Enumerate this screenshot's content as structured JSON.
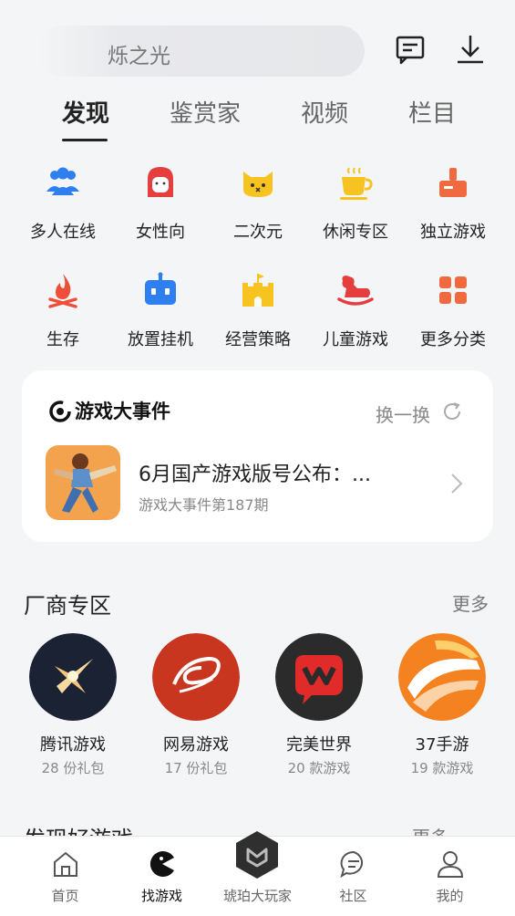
{
  "search": {
    "text": "烁之光"
  },
  "header": {
    "message_icon": "message-icon",
    "download_icon": "download-icon"
  },
  "tabs": [
    {
      "label": "发现",
      "active": true
    },
    {
      "label": "鉴赏家",
      "active": false
    },
    {
      "label": "视频",
      "active": false
    },
    {
      "label": "栏目",
      "active": false
    }
  ],
  "categories": [
    {
      "label": "多人在线",
      "icon": "people-icon",
      "color": "#2f7ff0"
    },
    {
      "label": "女性向",
      "icon": "girl-icon",
      "color": "#e53e3e"
    },
    {
      "label": "二次元",
      "icon": "cat-icon",
      "color": "#f7c321"
    },
    {
      "label": "休闲专区",
      "icon": "cup-icon",
      "color": "#f7c321"
    },
    {
      "label": "独立游戏",
      "icon": "joystick-icon",
      "color": "#f06a3f"
    },
    {
      "label": "生存",
      "icon": "campfire-icon",
      "color": "#ef4f3a"
    },
    {
      "label": "放置挂机",
      "icon": "robot-icon",
      "color": "#2f7ff0"
    },
    {
      "label": "经营策略",
      "icon": "castle-icon",
      "color": "#f7c321"
    },
    {
      "label": "儿童游戏",
      "icon": "rocking-horse-icon",
      "color": "#e53e3e"
    },
    {
      "label": "更多分类",
      "icon": "grid-icon",
      "color": "#f06a3f"
    }
  ],
  "event": {
    "title": "游戏大事件",
    "swap_label": "换一换",
    "headline": "6月国产游戏版号公布：...",
    "subtitle": "游戏大事件第187期"
  },
  "vendors_section": {
    "title": "厂商专区",
    "more": "更多",
    "items": [
      {
        "name": "腾讯游戏",
        "meta": "28 份礼包",
        "icon": "tencent-logo",
        "color": "#1b2233"
      },
      {
        "name": "网易游戏",
        "meta": "17 份礼包",
        "icon": "netease-logo",
        "color": "#c8361f"
      },
      {
        "name": "完美世界",
        "meta": "20 款游戏",
        "icon": "perfect-world-logo",
        "color": "#2b2b2b"
      },
      {
        "name": "37手游",
        "meta": "19 款游戏",
        "icon": "37-logo",
        "color": "#f58220"
      }
    ]
  },
  "discover_section": {
    "title": "发现好游戏",
    "more": "更多"
  },
  "bottom_nav": [
    {
      "label": "首页",
      "icon": "home-icon",
      "active": false
    },
    {
      "label": "找游戏",
      "icon": "pacman-icon",
      "active": true
    },
    {
      "label": "琥珀大玩家",
      "icon": "amber-badge-icon",
      "active": false
    },
    {
      "label": "社区",
      "icon": "community-icon",
      "active": false
    },
    {
      "label": "我的",
      "icon": "profile-icon",
      "active": false
    }
  ]
}
